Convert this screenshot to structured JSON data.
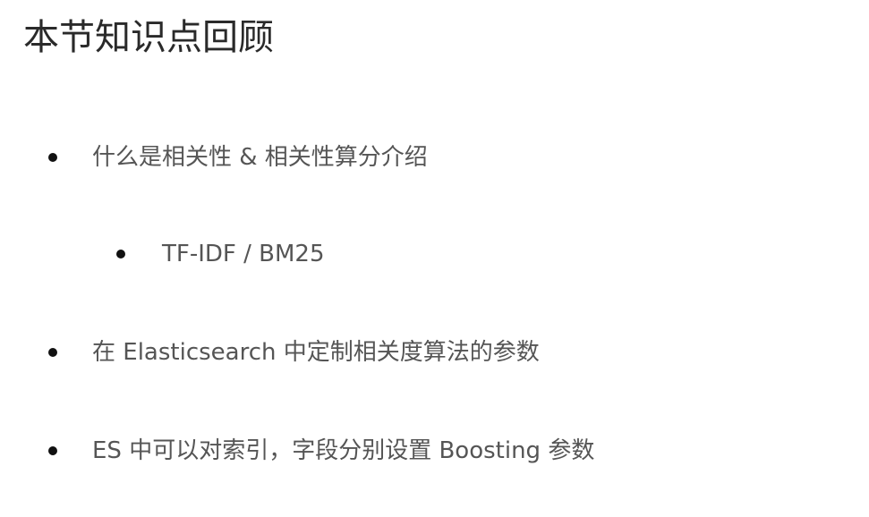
{
  "slide": {
    "title": "本节知识点回顾",
    "items": [
      {
        "text": "什么是相关性 & 相关性算分介绍",
        "level": 1
      },
      {
        "text": "TF-IDF / BM25",
        "level": 2
      },
      {
        "text": "在 Elasticsearch 中定制相关度算法的参数",
        "level": 1
      },
      {
        "text": "ES 中可以对索引，字段分别设置 Boosting 参数",
        "level": 1
      }
    ]
  }
}
